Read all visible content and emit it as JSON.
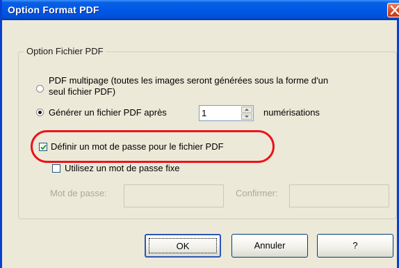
{
  "window": {
    "title": "Option Format PDF"
  },
  "group": {
    "label": "Option Fichier PDF"
  },
  "options": {
    "multipage_line1": "PDF multipage (toutes les images seront générées sous la forme d'un",
    "multipage_line2": "seul fichier PDF)",
    "generate_label": "Générer un fichier PDF après",
    "generate_count": "1",
    "generate_suffix": "numérisations",
    "selected": "generate"
  },
  "password": {
    "define_label": "Définir un mot de passe pour le fichier PDF",
    "define_checked": true,
    "fixed_label": "Utilisez un mot de passe fixe",
    "fixed_checked": false,
    "password_label": "Mot de passe:",
    "confirm_label": "Confirmer:"
  },
  "buttons": {
    "ok": "OK",
    "cancel": "Annuler",
    "help": "?"
  },
  "colors": {
    "titlebar": "#0058e6",
    "dialog_bg": "#ece9d8",
    "highlight": "#e8141b",
    "disabled_text": "#aca899"
  }
}
